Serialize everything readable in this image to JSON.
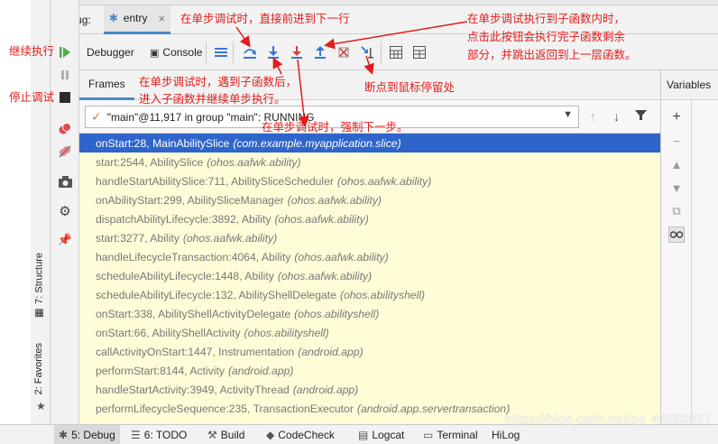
{
  "window": {
    "debug_label": "Debug:",
    "tab_entry": "entry"
  },
  "toolbar": {
    "debugger_tab": "Debugger",
    "console_tab": "Console"
  },
  "frames": {
    "tab": "Frames",
    "variables_tab": "Variables"
  },
  "thread": {
    "label": "\"main\"@11,917 in group \"main\": RUNNING"
  },
  "frames_list": [
    {
      "method": "onStart:28, MainAbilitySlice",
      "pkg": "(com.example.myapplication.slice)"
    },
    {
      "method": "start:2544, AbilitySlice",
      "pkg": "(ohos.aafwk.ability)"
    },
    {
      "method": "handleStartAbilitySlice:711, AbilitySliceScheduler",
      "pkg": "(ohos.aafwk.ability)"
    },
    {
      "method": "onAbilityStart:299, AbilitySliceManager",
      "pkg": "(ohos.aafwk.ability)"
    },
    {
      "method": "dispatchAbilityLifecycle:3892, Ability",
      "pkg": "(ohos.aafwk.ability)"
    },
    {
      "method": "start:3277, Ability",
      "pkg": "(ohos.aafwk.ability)"
    },
    {
      "method": "handleLifecycleTransaction:4064, Ability",
      "pkg": "(ohos.aafwk.ability)"
    },
    {
      "method": "scheduleAbilityLifecycle:1448, Ability",
      "pkg": "(ohos.aafwk.ability)"
    },
    {
      "method": "scheduleAbilityLifecycle:132, AbilityShellDelegate",
      "pkg": "(ohos.abilityshell)"
    },
    {
      "method": "onStart:338, AbilityShellActivityDelegate",
      "pkg": "(ohos.abilityshell)"
    },
    {
      "method": "onStart:66, AbilityShellActivity",
      "pkg": "(ohos.abilityshell)"
    },
    {
      "method": "callActivityOnStart:1447, Instrumentation",
      "pkg": "(android.app)"
    },
    {
      "method": "performStart:8144, Activity",
      "pkg": "(android.app)"
    },
    {
      "method": "handleStartActivity:3949, ActivityThread",
      "pkg": "(android.app)"
    },
    {
      "method": "performLifecycleSequence:235, TransactionExecutor",
      "pkg": "(android.app.servertransaction)"
    }
  ],
  "side_tabs": {
    "structure": "7: Structure",
    "favorites": "2: Favorites"
  },
  "bottom_bar": {
    "debug": "5: Debug",
    "todo": "6: TODO",
    "build": "Build",
    "codecheck": "CodeCheck",
    "logcat": "Logcat",
    "terminal": "Terminal",
    "hilog": "HiLog"
  },
  "watermark": "https://blog.csdn.net/qq_43680027",
  "annotations": {
    "step_over": "在单步调试时，直接前进到下一行",
    "step_out_l1": "在单步调试执行到子函数内时，",
    "step_out_l2": "点击此按钮会执行完子函数剩余",
    "step_out_l3": "部分，并跳出返回到上一层函数。",
    "resume": "继续执行",
    "stop": "停止调试",
    "step_into_l1": "在单步调试时，遇到子函数后，",
    "step_into_l2": "进入子函数并继续单步执行。",
    "run_to_cursor": "断点到鼠标停留处",
    "force_step": "在单步调试时，强制下一步。"
  },
  "colors": {
    "annotation": "#e21b1b",
    "selection": "#2f65ca",
    "frames_bg": "#fefdd7",
    "accent": "#4a88c7"
  }
}
